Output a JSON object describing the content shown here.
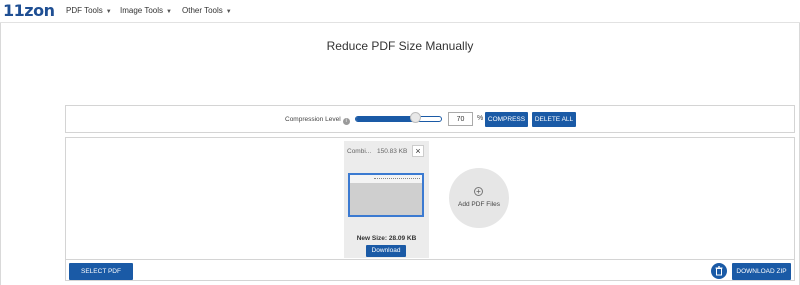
{
  "header": {
    "logo": "11zon",
    "nav": [
      {
        "label": "PDF Tools",
        "icon": "chevron-down-icon"
      },
      {
        "label": "Image Tools",
        "icon": "chevron-down-icon"
      },
      {
        "label": "Other Tools",
        "icon": "chevron-down-icon"
      }
    ]
  },
  "page": {
    "title": "Reduce PDF Size Manually"
  },
  "controls": {
    "compression_label": "Compression Level",
    "info_icon": "info-icon",
    "level_value": "70",
    "level_percent": 70,
    "percent_sign": "%",
    "compress_label": "COMPRESS",
    "delete_all_label": "DELETE ALL"
  },
  "file": {
    "name": "Combi...",
    "size": "150.83 KB",
    "close_glyph": "×",
    "new_size": "New Size: 28.09 KB",
    "download_label": "Download"
  },
  "add": {
    "label": "Add PDF Files",
    "icon": "plus-circle-icon"
  },
  "footer": {
    "select_label": "SELECT PDF",
    "trash_icon": "trash-icon",
    "download_zip_label": "DOWNLOAD ZIP"
  },
  "colors": {
    "accent": "#1a5aa6",
    "logo": "#1f4f93"
  }
}
